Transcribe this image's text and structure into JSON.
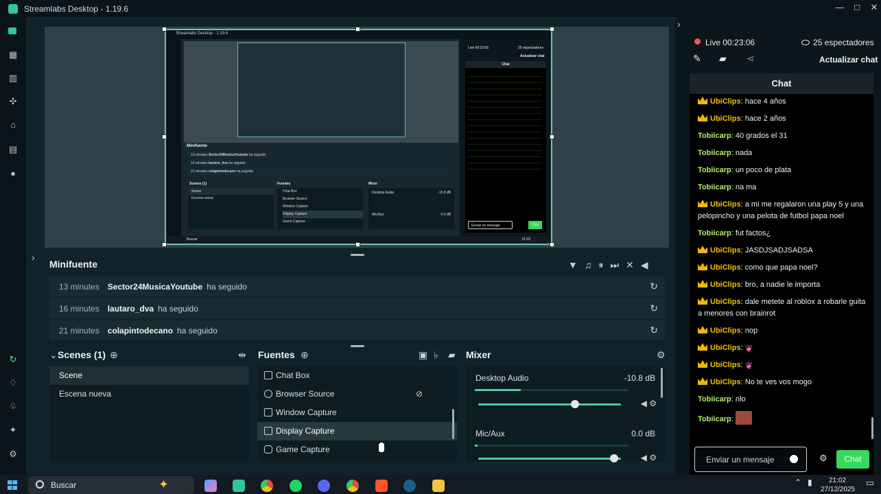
{
  "window": {
    "title": "Streamlabs Desktop - 1.19.6",
    "minimize": "—",
    "maximize": "□",
    "close": "✕"
  },
  "preview": {
    "mini_title": "Streamlabs Desktop - 1.19.6",
    "mini_live": "Live 00:23:06",
    "mini_viewers": "25 espectadores",
    "mini_update_chat": "Actualizar chat",
    "mini_chat": "Chat",
    "mini_minifuente": "Minifuente",
    "mini_rows": [
      {
        "time": "13 minutes",
        "user": "Sector24MusicaYoutube",
        "action": "ha seguido"
      },
      {
        "time": "16 minutes",
        "user": "lautaro_dva",
        "action": "ha seguido"
      },
      {
        "time": "21 minutes",
        "user": "colapintodecano",
        "action": "ha seguido"
      }
    ],
    "mini_scenes": "Scenes (1)",
    "mini_scene_items": [
      "Scene",
      "Escena nueva"
    ],
    "mini_fuentes": "Fuentes",
    "mini_sources": [
      "Chat Box",
      "Browser Source",
      "Window Capture",
      "Display Capture",
      "Game Capture"
    ],
    "mini_mixer": "Mixer",
    "mini_desktop": "Desktop Audio",
    "mini_desktop_db": "-10.8 dB",
    "mini_mic": "Mic/Aux",
    "mini_mic_db": "0.0 dB",
    "mini_search": "Buscar",
    "mini_chat_input": "Enviar un mensaje",
    "mini_chat_btn": "Chat",
    "mini_clock": "21:02"
  },
  "minifuente": {
    "title": "Minifuente",
    "rows": [
      {
        "time": "13 minutes",
        "user": "Sector24MusicaYoutube",
        "action": "ha seguido"
      },
      {
        "time": "16 minutes",
        "user": "lautaro_dva",
        "action": "ha seguido"
      },
      {
        "time": "21 minutes",
        "user": "colapintodecano",
        "action": "ha seguido"
      }
    ]
  },
  "scenes": {
    "title": "Scenes (1)",
    "items": [
      "Scene",
      "Escena nueva"
    ]
  },
  "sources": {
    "title": "Fuentes",
    "items": [
      "Chat Box",
      "Browser Source",
      "Window Capture",
      "Display Capture",
      "Game Capture"
    ]
  },
  "mixer": {
    "title": "Mixer",
    "channels": [
      {
        "label": "Desktop Audio",
        "db": "-10.8 dB",
        "meter": 0.3,
        "fader": 0.68
      },
      {
        "label": "Mic/Aux",
        "db": "0.0 dB",
        "meter": 0.02,
        "fader": 0.95
      }
    ]
  },
  "stream": {
    "live": "Live 00:23:06",
    "viewers": "25 espectadores",
    "update_chat": "Actualizar chat"
  },
  "chat": {
    "title": "Chat",
    "messages": [
      {
        "user": "UbiClips",
        "text": "hace 4 años"
      },
      {
        "user": "UbiClips",
        "text": "hace 2 años"
      },
      {
        "user": "Tobiicarp",
        "text": "40 grados el 31"
      },
      {
        "user": "Tobiicarp",
        "text": "nada"
      },
      {
        "user": "Tobiicarp",
        "text": "un poco de plata"
      },
      {
        "user": "Tobiicarp",
        "text": "na ma"
      },
      {
        "user": "UbiClips",
        "text": "a mi me regalaron una play 5 y una pelopincho y una pelota de futbol papa noel"
      },
      {
        "user": "Tobiicarp",
        "text": "fut factos¿"
      },
      {
        "user": "UbiClips",
        "text": "JASDJSADJSADSA"
      },
      {
        "user": "UbiClips",
        "text": "como que papa noel?"
      },
      {
        "user": "UbiClips",
        "text": "bro, a nadie le importa"
      },
      {
        "user": "UbiClips",
        "text": "dale metete al roblox a robarle guita a menores con brainrot"
      },
      {
        "user": "UbiClips",
        "text": "nop"
      },
      {
        "user": "UbiClips",
        "text": ""
      },
      {
        "user": "UbiClips",
        "text": ""
      },
      {
        "user": "UbiClips",
        "text": "No te ves vos mogo"
      },
      {
        "user": "Tobiicarp",
        "text": "nlo"
      },
      {
        "user": "Tobiicarp",
        "text": ""
      }
    ],
    "input_placeholder": "Enviar un mensaje",
    "send_label": "Chat"
  },
  "taskbar": {
    "search": "Buscar",
    "time": "21:02",
    "date": "27/12/2025"
  },
  "colors": {
    "accent": "#38d75f",
    "brand": "#31c3a2",
    "gold_user": "#f2c200",
    "green_user": "#b5f06a"
  }
}
